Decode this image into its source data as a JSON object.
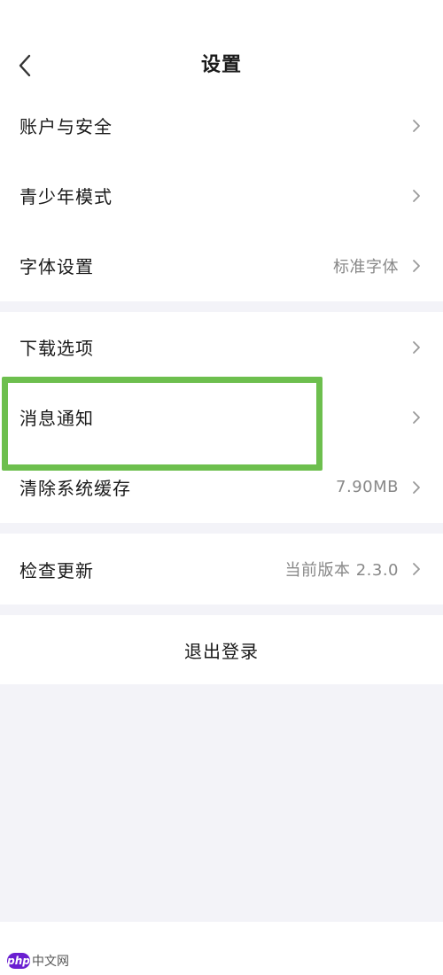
{
  "header": {
    "title": "设置",
    "back_icon": "chevron-left-icon"
  },
  "groups": [
    {
      "items": [
        {
          "label": "账户与安全",
          "value": ""
        },
        {
          "label": "青少年模式",
          "value": ""
        },
        {
          "label": "字体设置",
          "value": "标准字体"
        }
      ]
    },
    {
      "items": [
        {
          "label": "下载选项",
          "value": ""
        },
        {
          "label": "消息通知",
          "value": ""
        },
        {
          "label": "清除系统缓存",
          "value": "7.90MB"
        }
      ]
    },
    {
      "items": [
        {
          "label": "检查更新",
          "value": "当前版本 2.3.0"
        }
      ]
    }
  ],
  "logout": {
    "label": "退出登录"
  },
  "highlight": {
    "target": "消息通知",
    "color": "#6dbf4e"
  },
  "watermark": {
    "logo": "php",
    "text": "中文网"
  },
  "colors": {
    "background": "#f3f3f8",
    "card": "#ffffff",
    "secondary_text": "#888888"
  }
}
